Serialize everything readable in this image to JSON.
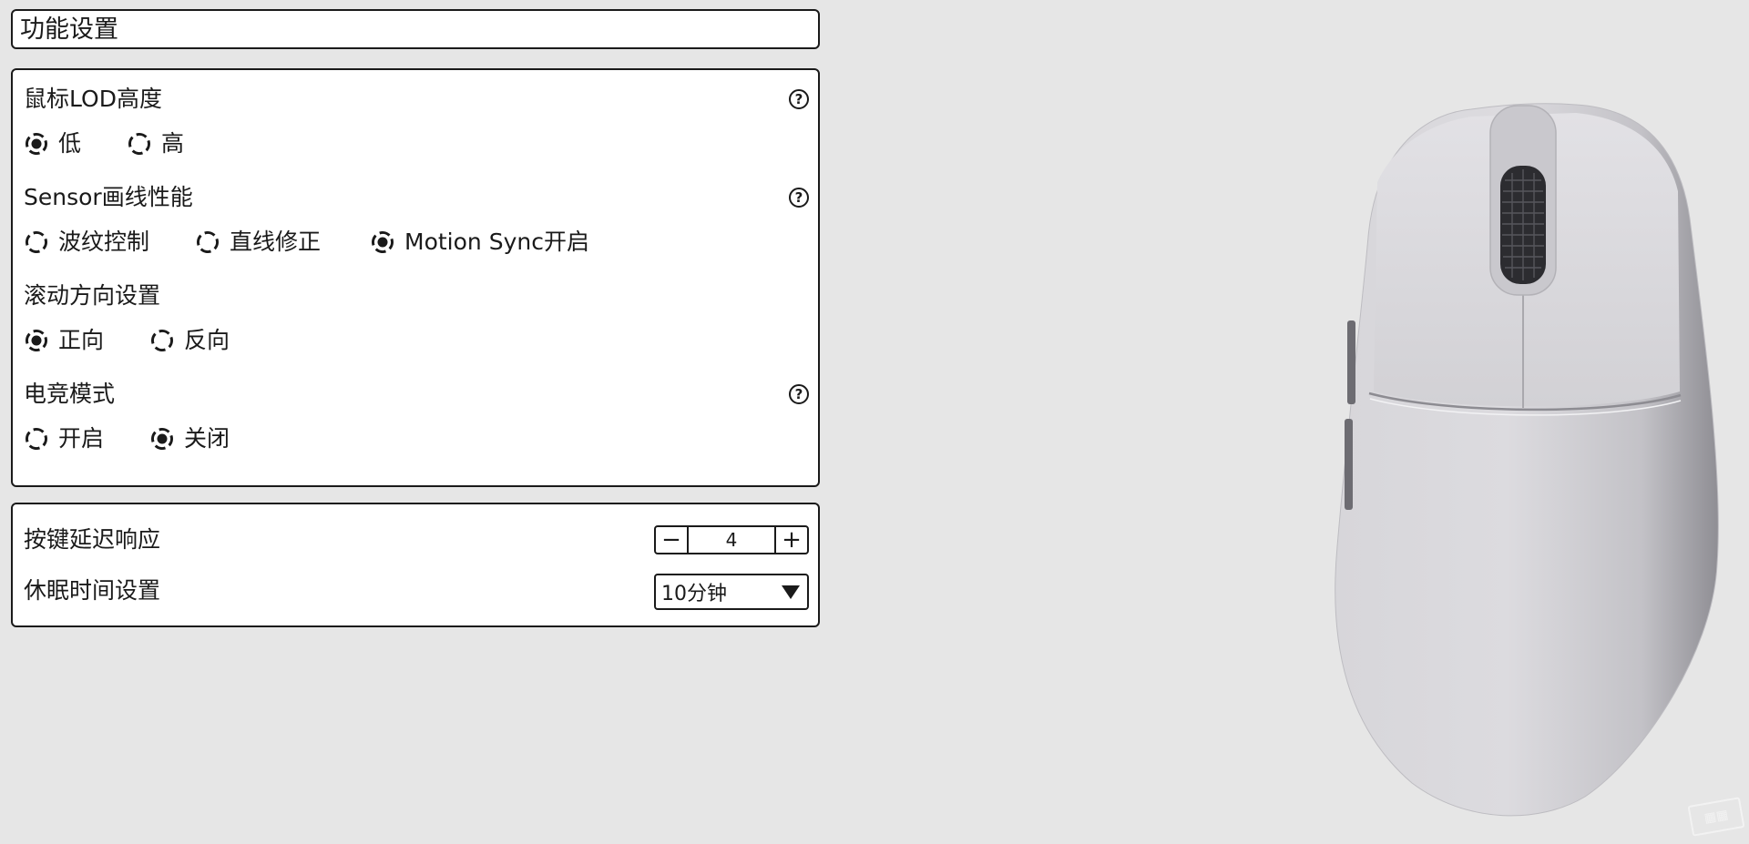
{
  "header": {
    "title": "功能设置"
  },
  "settings": {
    "lod": {
      "label": "鼠标LOD高度",
      "options": [
        {
          "label": "低",
          "selected": true
        },
        {
          "label": "高",
          "selected": false
        }
      ]
    },
    "sensor": {
      "label": "Sensor画线性能",
      "options": [
        {
          "label": "波纹控制",
          "selected": false
        },
        {
          "label": "直线修正",
          "selected": false
        },
        {
          "label": "Motion Sync开启",
          "selected": true
        }
      ]
    },
    "scroll": {
      "label": "滚动方向设置",
      "options": [
        {
          "label": "正向",
          "selected": true
        },
        {
          "label": "反向",
          "selected": false
        }
      ]
    },
    "esports": {
      "label": "电竞模式",
      "options": [
        {
          "label": "开启",
          "selected": false
        },
        {
          "label": "关闭",
          "selected": true
        }
      ]
    },
    "help_glyph": "?"
  },
  "misc": {
    "debounce": {
      "label": "按键延迟响应",
      "value": "4",
      "minus": "−",
      "plus": "+"
    },
    "sleep": {
      "label": "休眠时间设置",
      "value": "10分钟"
    }
  },
  "colors": {
    "background": "#e6e6e6",
    "panel": "#ffffff",
    "border": "#1a1a1a",
    "mouse_body": "#d9d8dc"
  },
  "icons": [
    "help-icon",
    "radio-selected-icon",
    "radio-unselected-icon",
    "dropdown-caret-icon",
    "mouse-image",
    "watermark-logo"
  ]
}
